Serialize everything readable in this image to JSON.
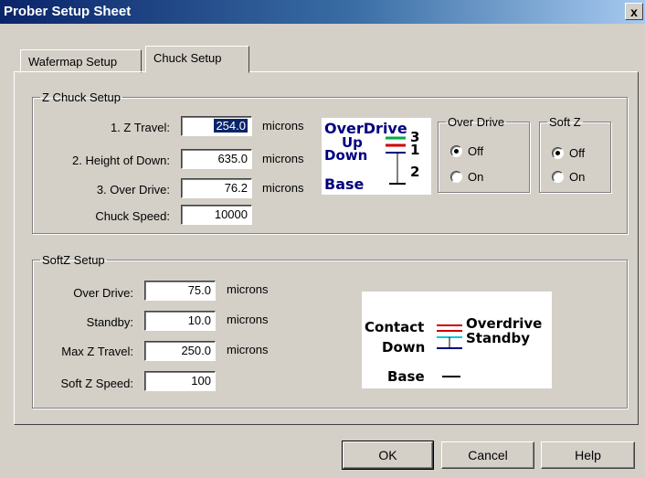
{
  "window": {
    "title": "Prober Setup Sheet",
    "close_glyph": "x"
  },
  "tabs": [
    {
      "label": "Wafermap Setup",
      "active": false
    },
    {
      "label": "Chuck Setup",
      "active": true
    }
  ],
  "z_chuck": {
    "legend": "Z Chuck Setup",
    "fields": [
      {
        "label": "1. Z Travel:",
        "value": "254.0",
        "unit": "microns"
      },
      {
        "label": "2. Height of Down:",
        "value": "635.0",
        "unit": "microns"
      },
      {
        "label": "3. Over Drive:",
        "value": "76.2",
        "unit": "microns"
      },
      {
        "label": "Chuck Speed:",
        "value": "10000"
      }
    ],
    "diagram": {
      "labels": [
        "OverDrive",
        "Up",
        "Down",
        "Base"
      ],
      "numbers": [
        "3",
        "1",
        "2"
      ]
    },
    "over_drive": {
      "legend": "Over Drive",
      "options": [
        "Off",
        "On"
      ],
      "selected": "Off"
    },
    "soft_z": {
      "legend": "Soft Z",
      "options": [
        "Off",
        "On"
      ],
      "selected": "Off"
    }
  },
  "softz_setup": {
    "legend": "SoftZ Setup",
    "fields": [
      {
        "label": "Over Drive:",
        "value": "75.0",
        "unit": "microns"
      },
      {
        "label": "Standby:",
        "value": "10.0",
        "unit": "microns"
      },
      {
        "label": "Max Z Travel:",
        "value": "250.0",
        "unit": "microns"
      },
      {
        "label": "Soft Z Speed:",
        "value": "100"
      }
    ],
    "diagram": {
      "labels": [
        "Contact",
        "Down",
        "Base",
        "Overdrive",
        "Standby"
      ]
    }
  },
  "buttons": {
    "ok": "OK",
    "cancel": "Cancel",
    "help": "Help"
  },
  "colors": {
    "overdrive_line": "#00aa44",
    "up_line": "#cc0000",
    "down_line": "#000080",
    "standby_line": "#00c8d8"
  }
}
